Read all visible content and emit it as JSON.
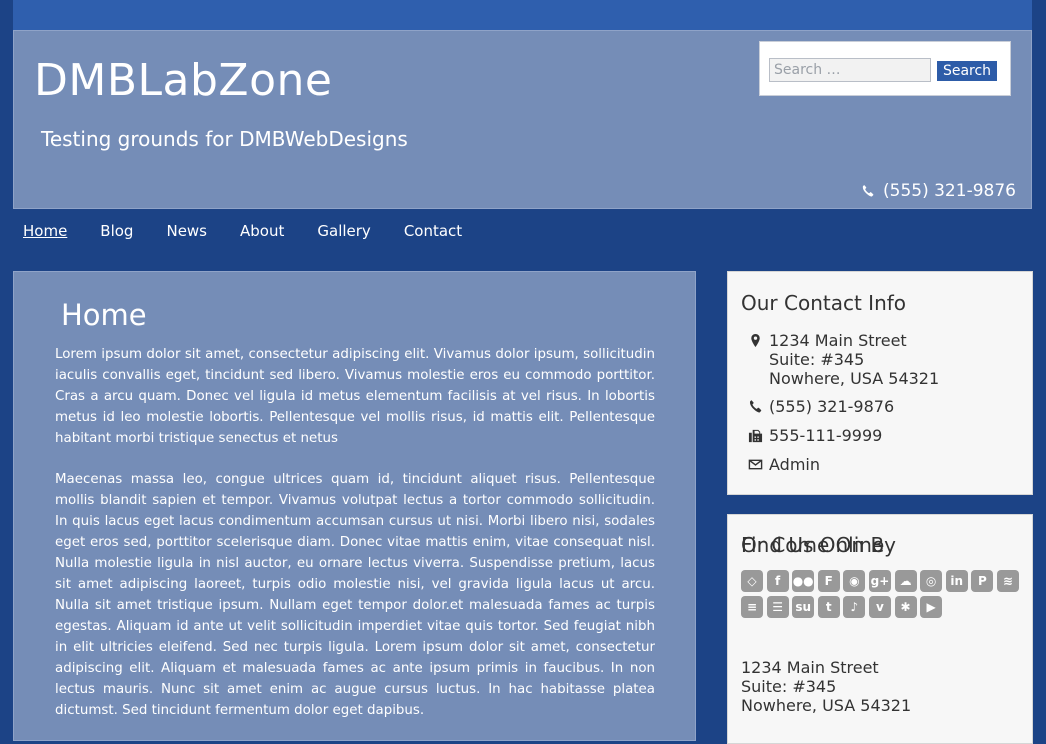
{
  "site": {
    "title": "DMBLabZone",
    "tagline": "Testing grounds for DMBWebDesigns"
  },
  "search": {
    "placeholder": "Search …",
    "button_label": "Search"
  },
  "header_phone": "(555) 321-9876",
  "nav": [
    {
      "label": "Home",
      "active": true
    },
    {
      "label": "Blog"
    },
    {
      "label": "News"
    },
    {
      "label": "About"
    },
    {
      "label": "Gallery"
    },
    {
      "label": "Contact"
    }
  ],
  "main": {
    "heading": "Home",
    "paragraphs": [
      "Lorem ipsum dolor sit amet, consectetur adipiscing elit. Vivamus dolor ipsum, sollicitudin iaculis convallis eget, tincidunt sed libero. Vivamus molestie eros eu commodo porttitor. Cras a arcu quam. Donec vel ligula id metus elementum facilisis at vel risus. In lobortis metus id leo molestie lobortis. Pellentesque vel mollis risus, id mattis elit. Pellentesque habitant morbi tristique senectus et netus",
      "Maecenas massa leo, congue ultrices quam id, tincidunt aliquet risus. Pellentesque mollis blandit sapien et tempor. Vivamus volutpat lectus a tortor commodo sollicitudin. In quis lacus eget lacus condimentum accumsan cursus ut nisi. Morbi libero nisi, sodales eget eros sed, porttitor scelerisque diam. Donec vitae mattis enim, vitae consequat nisl. Nulla molestie ligula in nisl auctor, eu ornare lectus viverra. Suspendisse pretium, lacus sit amet adipiscing laoreet, turpis odio molestie nisi, vel gravida ligula lacus ut arcu. Nulla sit amet tristique ipsum. Nullam eget tempor dolor.et malesuada fames ac turpis egestas. Aliquam id ante ut velit sollicitudin imperdiet vitae quis tortor. Sed feugiat nibh in elit ultricies eleifend. Sed nec turpis ligula. Lorem ipsum dolor sit amet, consectetur adipiscing elit. Aliquam et malesuada fames ac ante ipsum primis in faucibus. In non lectus mauris. Nunc sit amet enim ac augue cursus luctus. In hac habitasse platea dictumst. Sed tincidunt fermentum dolor eget dapibus."
    ]
  },
  "contact_widget": {
    "title": "Our Contact Info",
    "address_line1": "1234 Main Street",
    "address_line2": "Suite: #345",
    "address_line3": "Nowhere, USA 54321",
    "phone": "(555) 321-9876",
    "fax": "555-111-9999",
    "email_label": "Admin"
  },
  "online_widget": {
    "title": "Find Us Online",
    "icons": [
      "codepen-icon",
      "facebook-icon",
      "flickr-icon",
      "foursquare-icon",
      "github-icon",
      "google-plus-icon",
      "soundcloud-icon",
      "instagram-icon",
      "linkedin-icon",
      "pinterest-icon",
      "rss-icon",
      "stack-exchange-icon",
      "stack-overflow-icon",
      "stumbleupon-icon",
      "tumblr-icon",
      "twitter-icon",
      "vimeo-icon",
      "yelp-icon",
      "youtube-icon"
    ],
    "or_come_by": "Or Come On By",
    "address_line1": "1234 Main Street",
    "address_line2": "Suite: #345",
    "address_line3": "Nowhere, USA 54321"
  },
  "colors": {
    "page_bg": "#1c4386",
    "topbar": "#2f5fae",
    "panel": "#758db7",
    "button": "#2d5ca8",
    "icon_gray": "#999999"
  }
}
